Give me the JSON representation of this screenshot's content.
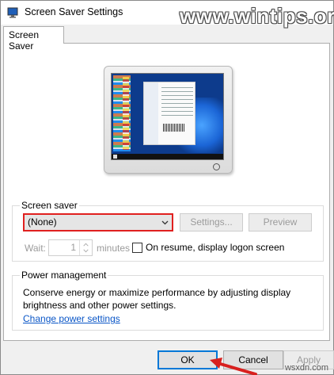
{
  "window": {
    "title": "Screen Saver Settings"
  },
  "watermark": {
    "text": "www.wintips.org"
  },
  "tabs": [
    {
      "label": "Screen Saver"
    }
  ],
  "screen_saver": {
    "group_label": "Screen saver",
    "selected": "(None)",
    "settings_label": "Settings...",
    "preview_label": "Preview",
    "wait_label": "Wait:",
    "wait_value": "1",
    "minutes_label": "minutes",
    "resume_label": "On resume, display logon screen",
    "resume_checked": false
  },
  "power": {
    "group_label": "Power management",
    "description": "Conserve energy or maximize performance by adjusting display brightness and other power settings.",
    "link": "Change power settings"
  },
  "buttons": {
    "ok": "OK",
    "cancel": "Cancel",
    "apply": "Apply"
  },
  "corner_watermark": "wsxdn.com",
  "colors": {
    "highlight": "#e0201f",
    "link": "#0a56c7",
    "focus": "#0078d7"
  },
  "icons": {
    "title": "screen-saver-icon",
    "combo_arrow": "chevron-down-icon",
    "spinner": "spinner-arrows-icon"
  }
}
